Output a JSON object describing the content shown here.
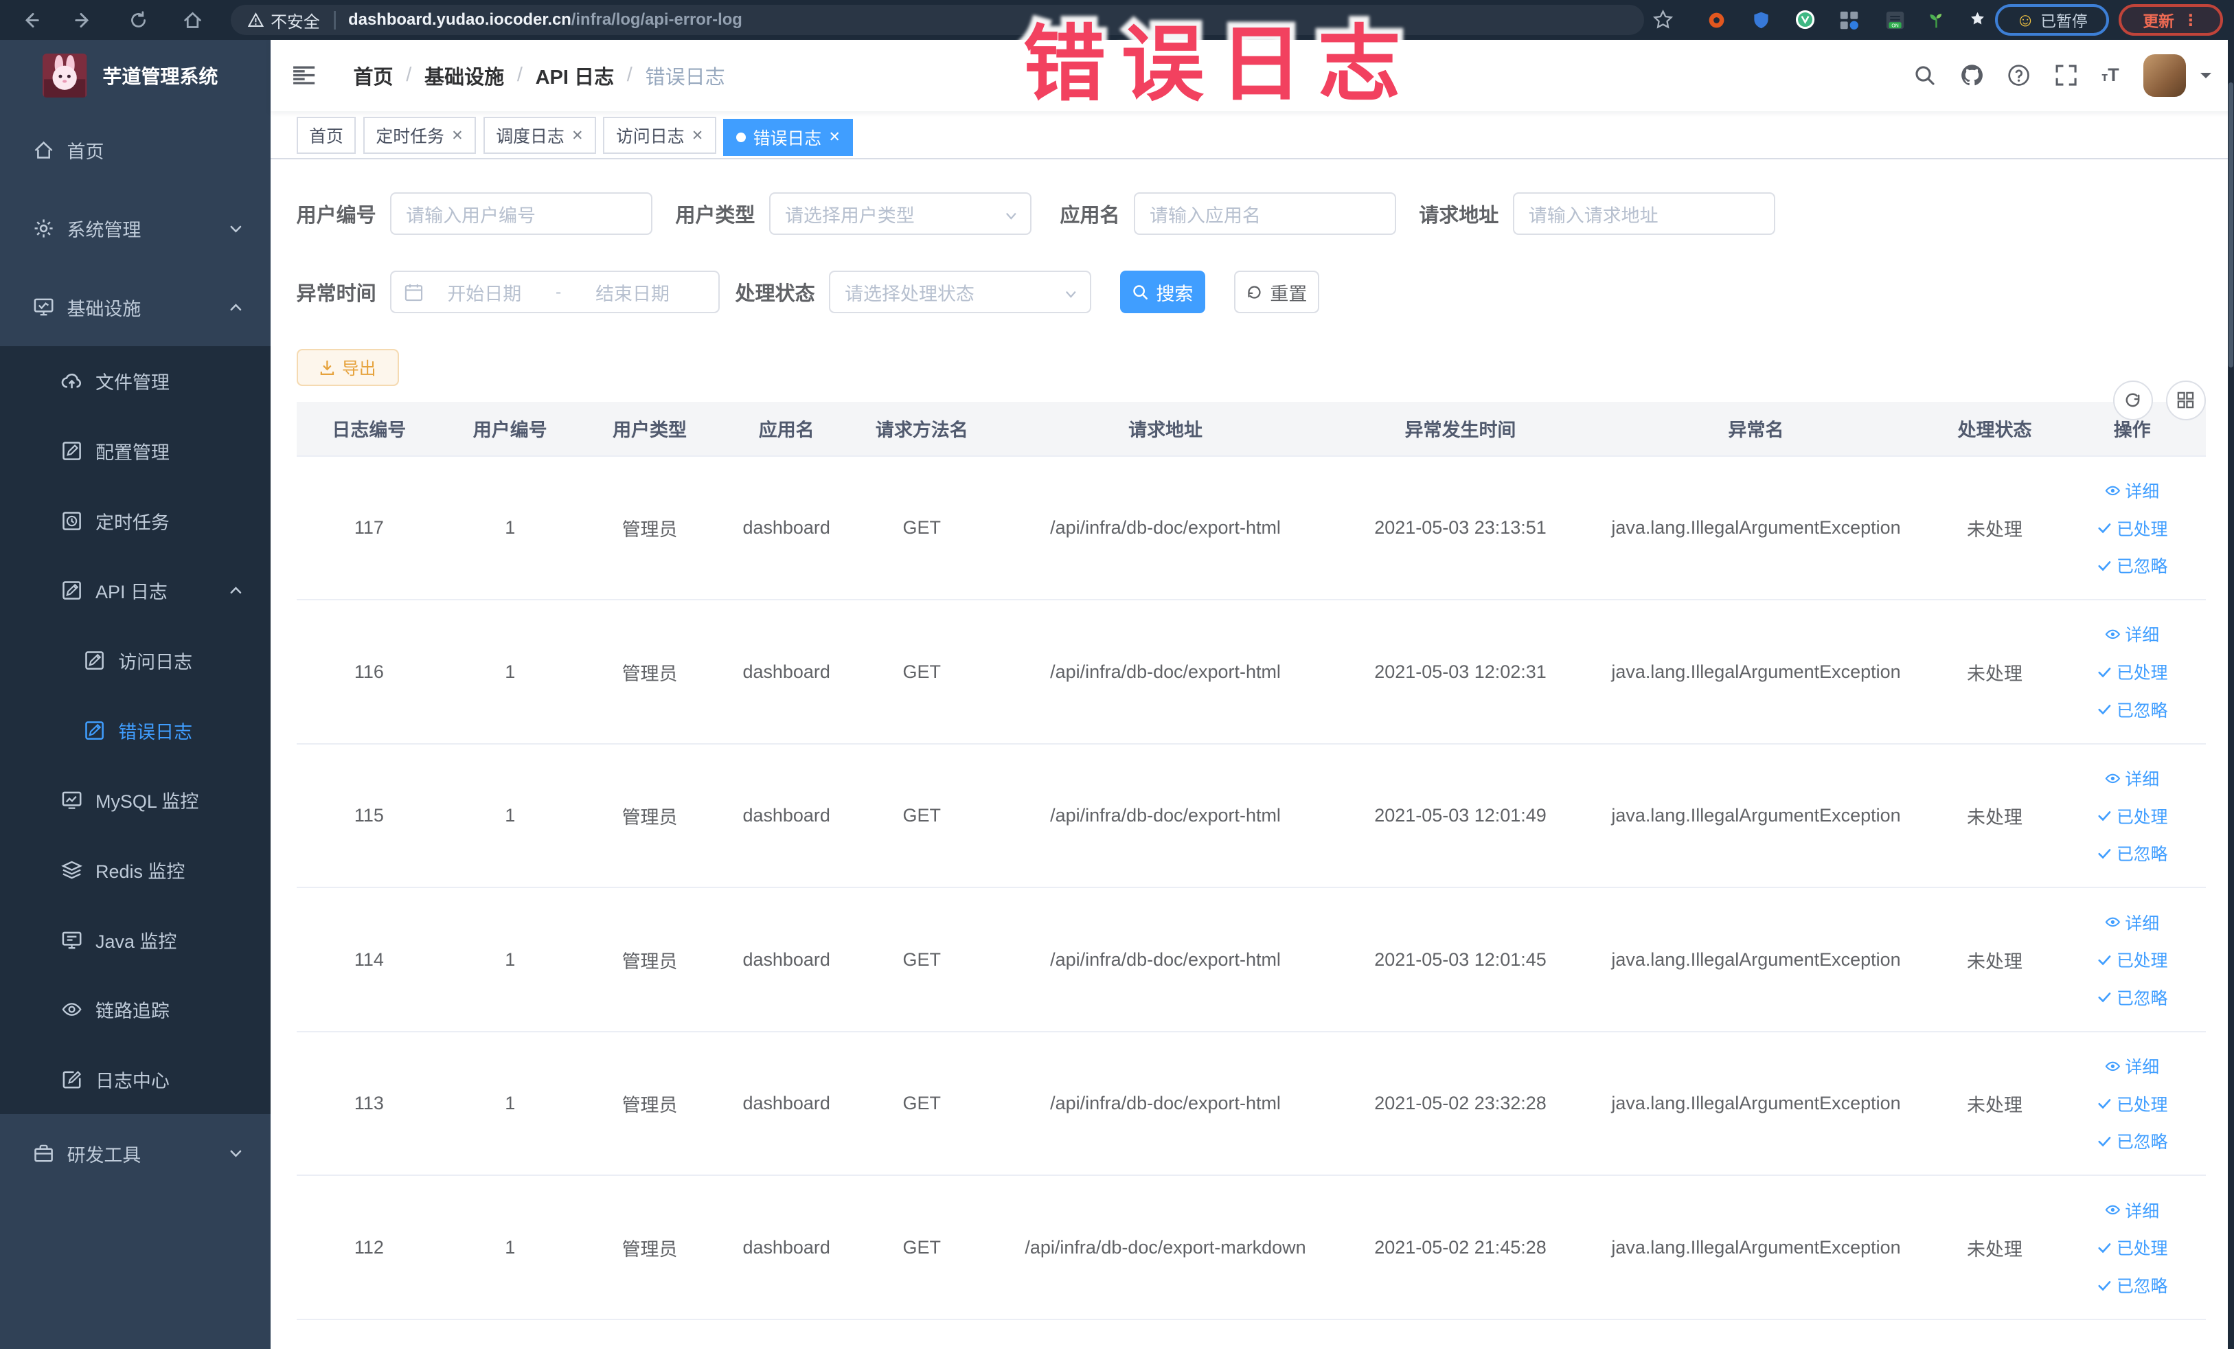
{
  "browser": {
    "security_label": "不安全",
    "url_host": "dashboard.yudao.iocoder.cn",
    "url_path": "/infra/log/api-error-log",
    "paused_badge_label": "已暂停",
    "update_button_label": "更新",
    "extension_icons": [
      "bookmark-star-icon",
      "adblock-icon",
      "shield-icon",
      "vue-devtools-icon",
      "tab-grid-icon",
      "switch-on-icon",
      "sprout-icon",
      "extension-icon"
    ]
  },
  "annotation": {
    "text": "错误日志",
    "color": "#f2415f"
  },
  "sidebar": {
    "logo_title": "芋道管理系统",
    "items": [
      {
        "label": "首页",
        "icon": "home-icon",
        "level": 0
      },
      {
        "label": "系统管理",
        "icon": "gear-icon",
        "level": 0,
        "chevron": "down"
      },
      {
        "label": "基础设施",
        "icon": "monitor-icon",
        "level": 0,
        "chevron": "up"
      },
      {
        "label": "文件管理",
        "icon": "upload-cloud-icon",
        "level": 1
      },
      {
        "label": "配置管理",
        "icon": "edit-icon",
        "level": 1
      },
      {
        "label": "定时任务",
        "icon": "schedule-icon",
        "level": 1
      },
      {
        "label": "API 日志",
        "icon": "log-icon",
        "level": 1,
        "chevron": "up"
      },
      {
        "label": "访问日志",
        "icon": "log-icon",
        "level": 2
      },
      {
        "label": "错误日志",
        "icon": "log-icon",
        "level": 2,
        "active": true
      },
      {
        "label": "MySQL 监控",
        "icon": "database-monitor-icon",
        "level": 1
      },
      {
        "label": "Redis 监控",
        "icon": "layers-icon",
        "level": 1
      },
      {
        "label": "Java 监控",
        "icon": "screen-icon",
        "level": 1
      },
      {
        "label": "链路追踪",
        "icon": "eye-icon",
        "level": 1
      },
      {
        "label": "日志中心",
        "icon": "log-center-icon",
        "level": 1
      },
      {
        "label": "研发工具",
        "icon": "toolbox-icon",
        "level": 0,
        "chevron": "down"
      }
    ]
  },
  "header": {
    "breadcrumb": [
      {
        "label": "首页"
      },
      {
        "label": "基础设施"
      },
      {
        "label": "API 日志"
      },
      {
        "label": "错误日志",
        "current": true
      }
    ]
  },
  "tabs": [
    {
      "label": "首页",
      "closable": false,
      "active": false
    },
    {
      "label": "定时任务",
      "closable": true,
      "active": false
    },
    {
      "label": "调度日志",
      "closable": true,
      "active": false
    },
    {
      "label": "访问日志",
      "closable": true,
      "active": false
    },
    {
      "label": "错误日志",
      "closable": true,
      "active": true
    }
  ],
  "filters": {
    "user_id_label": "用户编号",
    "user_id_placeholder": "请输入用户编号",
    "user_type_label": "用户类型",
    "user_type_placeholder": "请选择用户类型",
    "app_name_label": "应用名",
    "app_name_placeholder": "请输入应用名",
    "request_url_label": "请求地址",
    "request_url_placeholder": "请输入请求地址",
    "exception_time_label": "异常时间",
    "start_date_placeholder": "开始日期",
    "end_date_placeholder": "结束日期",
    "date_separator": "-",
    "process_status_label": "处理状态",
    "process_status_placeholder": "请选择处理状态",
    "search_label": "搜索",
    "reset_label": "重置"
  },
  "toolbar": {
    "export_label": "导出"
  },
  "table": {
    "columns": [
      "日志编号",
      "用户编号",
      "用户类型",
      "应用名",
      "请求方法名",
      "请求地址",
      "异常发生时间",
      "异常名",
      "处理状态",
      "操作"
    ],
    "actions": [
      "详细",
      "已处理",
      "已忽略"
    ],
    "rows": [
      {
        "id": "117",
        "user_id": "1",
        "user_type": "管理员",
        "app": "dashboard",
        "method": "GET",
        "url": "/api/infra/db-doc/export-html",
        "time": "2021-05-03 23:13:51",
        "exception": "java.lang.IllegalArgumentException",
        "status": "未处理"
      },
      {
        "id": "116",
        "user_id": "1",
        "user_type": "管理员",
        "app": "dashboard",
        "method": "GET",
        "url": "/api/infra/db-doc/export-html",
        "time": "2021-05-03 12:02:31",
        "exception": "java.lang.IllegalArgumentException",
        "status": "未处理"
      },
      {
        "id": "115",
        "user_id": "1",
        "user_type": "管理员",
        "app": "dashboard",
        "method": "GET",
        "url": "/api/infra/db-doc/export-html",
        "time": "2021-05-03 12:01:49",
        "exception": "java.lang.IllegalArgumentException",
        "status": "未处理"
      },
      {
        "id": "114",
        "user_id": "1",
        "user_type": "管理员",
        "app": "dashboard",
        "method": "GET",
        "url": "/api/infra/db-doc/export-html",
        "time": "2021-05-03 12:01:45",
        "exception": "java.lang.IllegalArgumentException",
        "status": "未处理"
      },
      {
        "id": "113",
        "user_id": "1",
        "user_type": "管理员",
        "app": "dashboard",
        "method": "GET",
        "url": "/api/infra/db-doc/export-html",
        "time": "2021-05-02 23:32:28",
        "exception": "java.lang.IllegalArgumentException",
        "status": "未处理"
      },
      {
        "id": "112",
        "user_id": "1",
        "user_type": "管理员",
        "app": "dashboard",
        "method": "GET",
        "url": "/api/infra/db-doc/export-markdown",
        "time": "2021-05-02 21:45:28",
        "exception": "java.lang.IllegalArgumentException",
        "status": "未处理"
      }
    ]
  }
}
